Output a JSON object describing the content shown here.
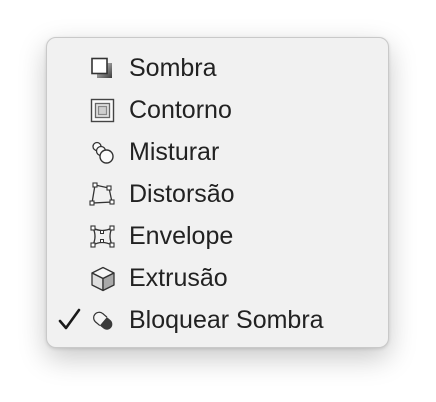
{
  "menu": {
    "items": [
      {
        "label": "Sombra",
        "icon": "shadow-icon",
        "checked": false
      },
      {
        "label": "Contorno",
        "icon": "contour-icon",
        "checked": false
      },
      {
        "label": "Misturar",
        "icon": "blend-icon",
        "checked": false
      },
      {
        "label": "Distorsão",
        "icon": "distort-icon",
        "checked": false
      },
      {
        "label": "Envelope",
        "icon": "envelope-icon",
        "checked": false
      },
      {
        "label": "Extrusão",
        "icon": "extrude-icon",
        "checked": false
      },
      {
        "label": "Bloquear Sombra",
        "icon": "block-shadow-icon",
        "checked": true
      }
    ]
  },
  "colors": {
    "menu_background": "#f1f1f1",
    "text": "#222222",
    "border": "#c9c9c9"
  }
}
